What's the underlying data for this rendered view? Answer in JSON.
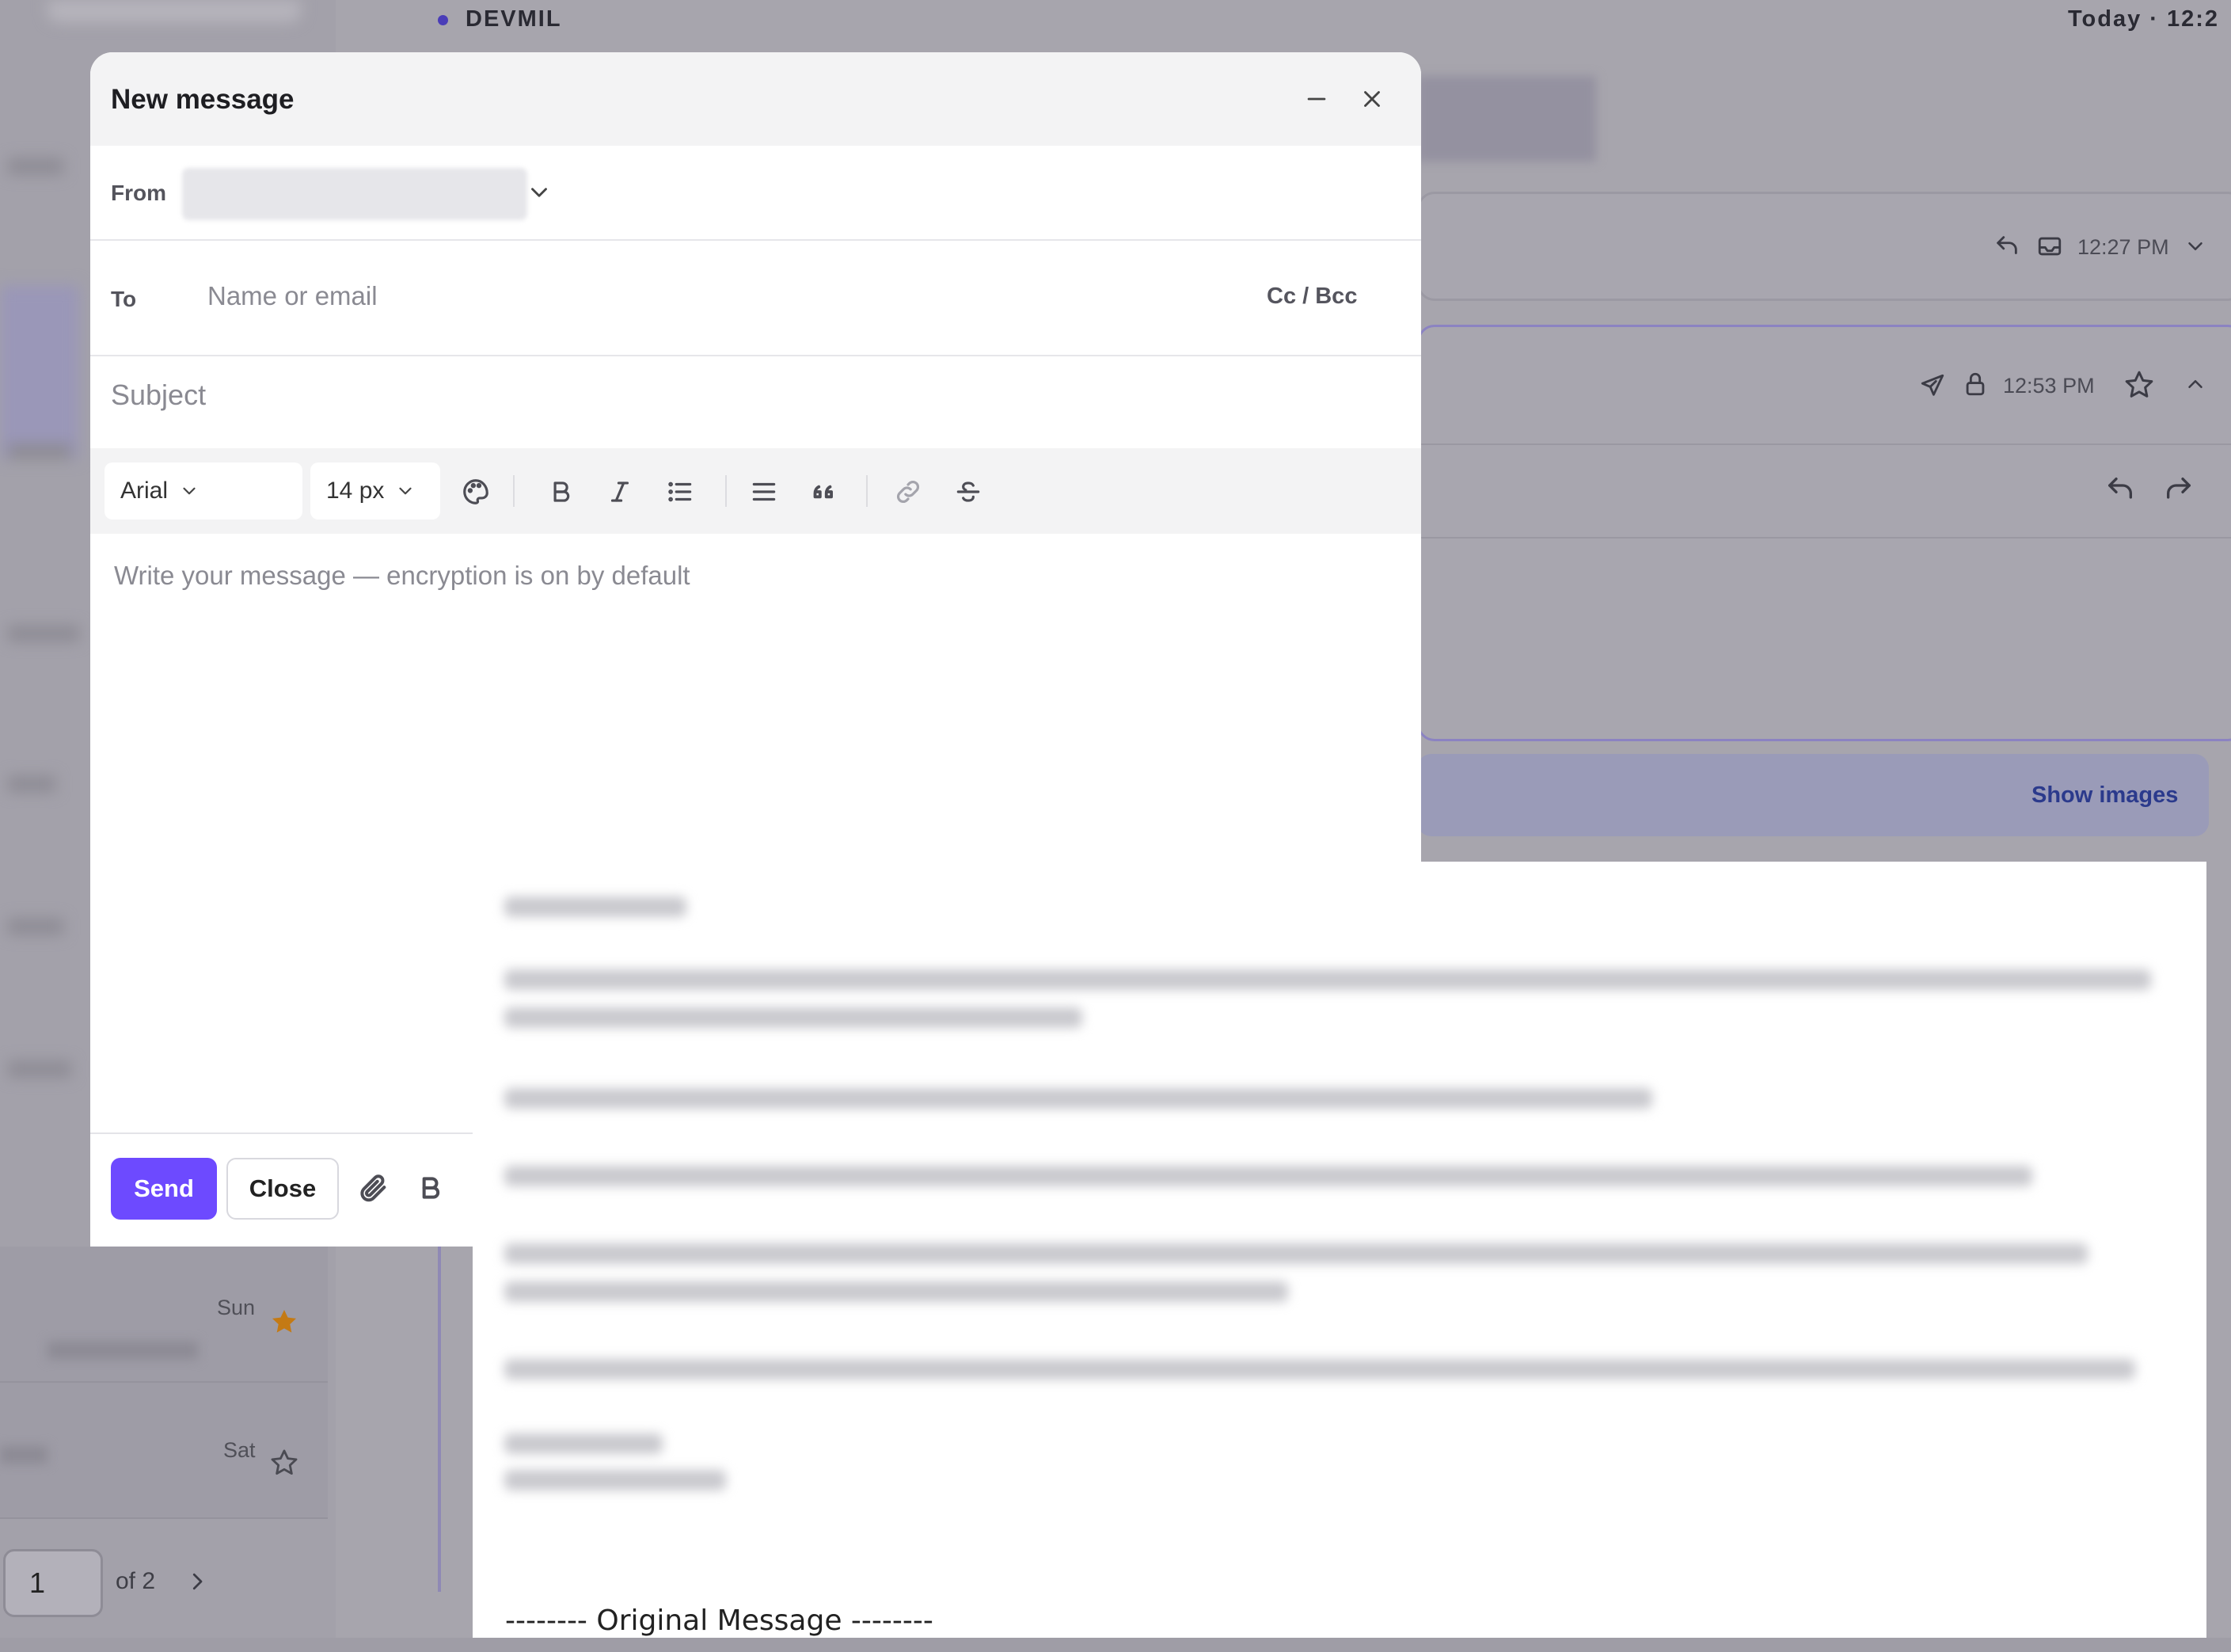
{
  "background": {
    "org_name": "DEVMIL",
    "timestamp_header": "Today · 12:2",
    "thread_times": [
      "12:27 PM",
      "12:53 PM"
    ],
    "show_images_label": "Show images",
    "message_list": {
      "rows": [
        {
          "day": "Sun",
          "starred": true
        },
        {
          "day": "Sat",
          "starred": false
        }
      ],
      "pagination": {
        "current_page": "1",
        "of_label": "of 2"
      }
    },
    "original_message_label": "-------- Original Message --------"
  },
  "compose": {
    "title": "New message",
    "from_label": "From",
    "to_label": "To",
    "to_placeholder": "Name or email",
    "cc_bcc_label": "Cc / Bcc",
    "subject_placeholder": "Subject",
    "toolbar": {
      "font_family": "Arial",
      "font_size": "14 px"
    },
    "body_placeholder": "Write your message — encryption is on by default",
    "send_label": "Send",
    "close_label": "Close"
  },
  "colors": {
    "accent": "#6d4aff",
    "star_filled": "#c47a14"
  }
}
